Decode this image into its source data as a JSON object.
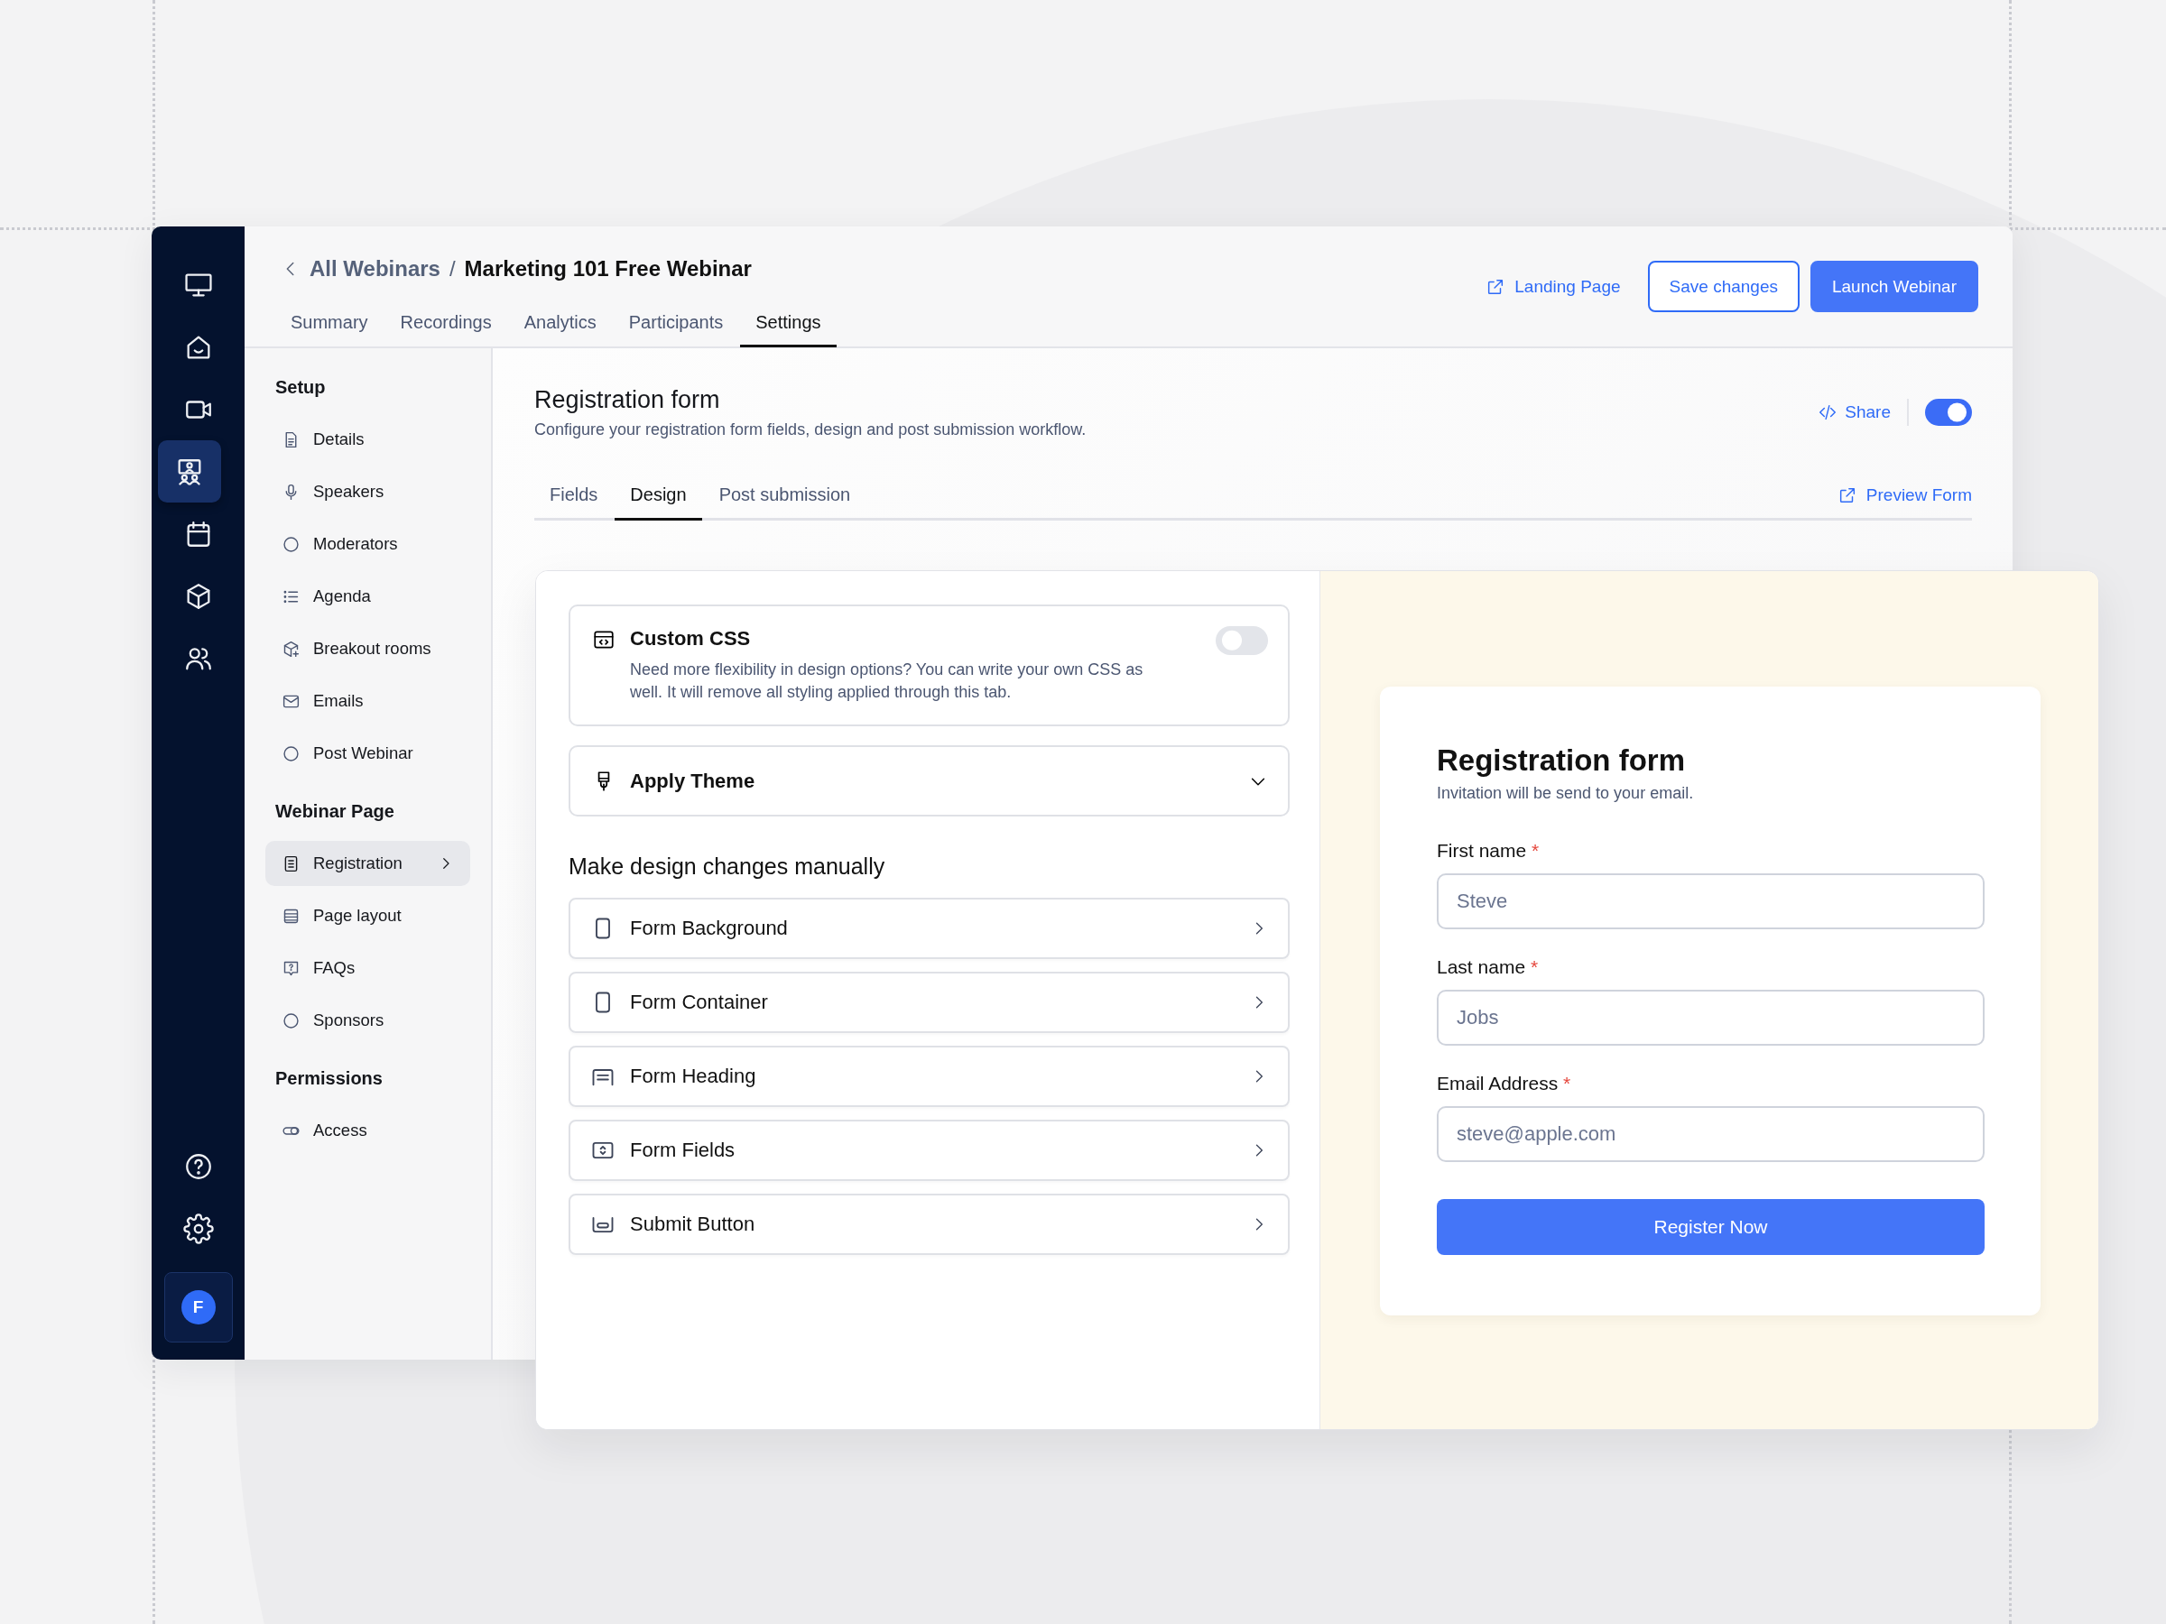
{
  "rail": {
    "items": [
      {
        "selected": false
      },
      {
        "selected": false
      },
      {
        "selected": false
      },
      {
        "selected": true
      },
      {
        "selected": false
      },
      {
        "selected": false
      },
      {
        "selected": false
      }
    ],
    "avatar": "F"
  },
  "breadcrumb": {
    "parent": "All Webinars",
    "separator": "/",
    "current": "Marketing 101 Free Webinar"
  },
  "tabs": [
    {
      "label": "Summary",
      "selected": false
    },
    {
      "label": "Recordings",
      "selected": false
    },
    {
      "label": "Analytics",
      "selected": false
    },
    {
      "label": "Participants",
      "selected": false
    },
    {
      "label": "Settings",
      "selected": true
    }
  ],
  "header_actions": {
    "landing_page": "Landing Page",
    "save": "Save changes",
    "launch": "Launch Webinar"
  },
  "settings_nav": {
    "sections": [
      {
        "title": "Setup",
        "items": [
          {
            "label": "Details",
            "selected": false
          },
          {
            "label": "Speakers",
            "selected": false
          },
          {
            "label": "Moderators",
            "selected": false
          },
          {
            "label": "Agenda",
            "selected": false
          },
          {
            "label": "Breakout rooms",
            "selected": false
          },
          {
            "label": "Emails",
            "selected": false
          },
          {
            "label": "Post Webinar",
            "selected": false
          }
        ]
      },
      {
        "title": "Webinar Page",
        "items": [
          {
            "label": "Registration",
            "selected": true
          },
          {
            "label": "Page layout",
            "selected": false
          },
          {
            "label": "FAQs",
            "selected": false
          },
          {
            "label": "Sponsors",
            "selected": false
          }
        ]
      },
      {
        "title": "Permissions",
        "items": [
          {
            "label": "Access",
            "selected": false
          }
        ]
      }
    ]
  },
  "registration": {
    "title": "Registration form",
    "description": "Configure your registration form fields, design and post submission workflow.",
    "share": "Share",
    "enabled": true,
    "tabs": [
      {
        "label": "Fields",
        "selected": false
      },
      {
        "label": "Design",
        "selected": true
      },
      {
        "label": "Post submission",
        "selected": false
      }
    ],
    "preview_link": "Preview Form"
  },
  "design": {
    "custom_css": {
      "title": "Custom CSS",
      "description": "Need more flexibility in design options? You can write your own CSS as well. It will remove all styling applied through this tab.",
      "on": false
    },
    "theme": {
      "label": "Apply Theme",
      "expanded": false
    },
    "heading": "Make design changes manually",
    "rows": [
      "Form Background",
      "Form Container",
      "Form Heading",
      "Form Fields",
      "Submit Button"
    ]
  },
  "preview": {
    "title": "Registration form",
    "subtitle": "Invitation will be send to your email.",
    "fields": [
      {
        "label": "First name",
        "required_mark": "*",
        "placeholder": "Steve"
      },
      {
        "label": "Last name",
        "required_mark": "*",
        "placeholder": "Jobs"
      },
      {
        "label": "Email Address",
        "required_mark": "*",
        "placeholder": "steve@apple.com"
      }
    ],
    "submit": "Register Now"
  }
}
